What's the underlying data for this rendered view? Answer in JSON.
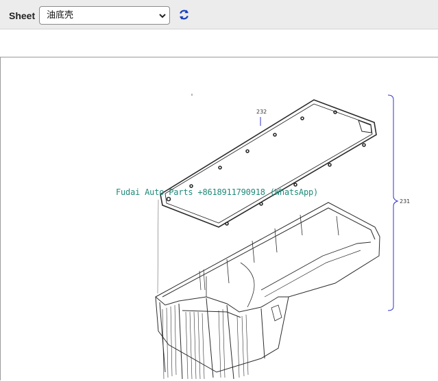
{
  "toolbar": {
    "sheet_label": "Sheet",
    "sheet_select": {
      "selected": "油底壳"
    },
    "refresh_icon": "refresh-icon"
  },
  "viewer": {
    "watermark": "Fudai Auto Parts +8618911790918 (WhatsApp)",
    "callouts": {
      "gasket": "232",
      "assembly": "231"
    }
  },
  "colors": {
    "toolbar_bg": "#ececec",
    "refresh_icon": "#1a3fbf",
    "callout_line": "#3333cc",
    "watermark": "#1f8a7a"
  }
}
